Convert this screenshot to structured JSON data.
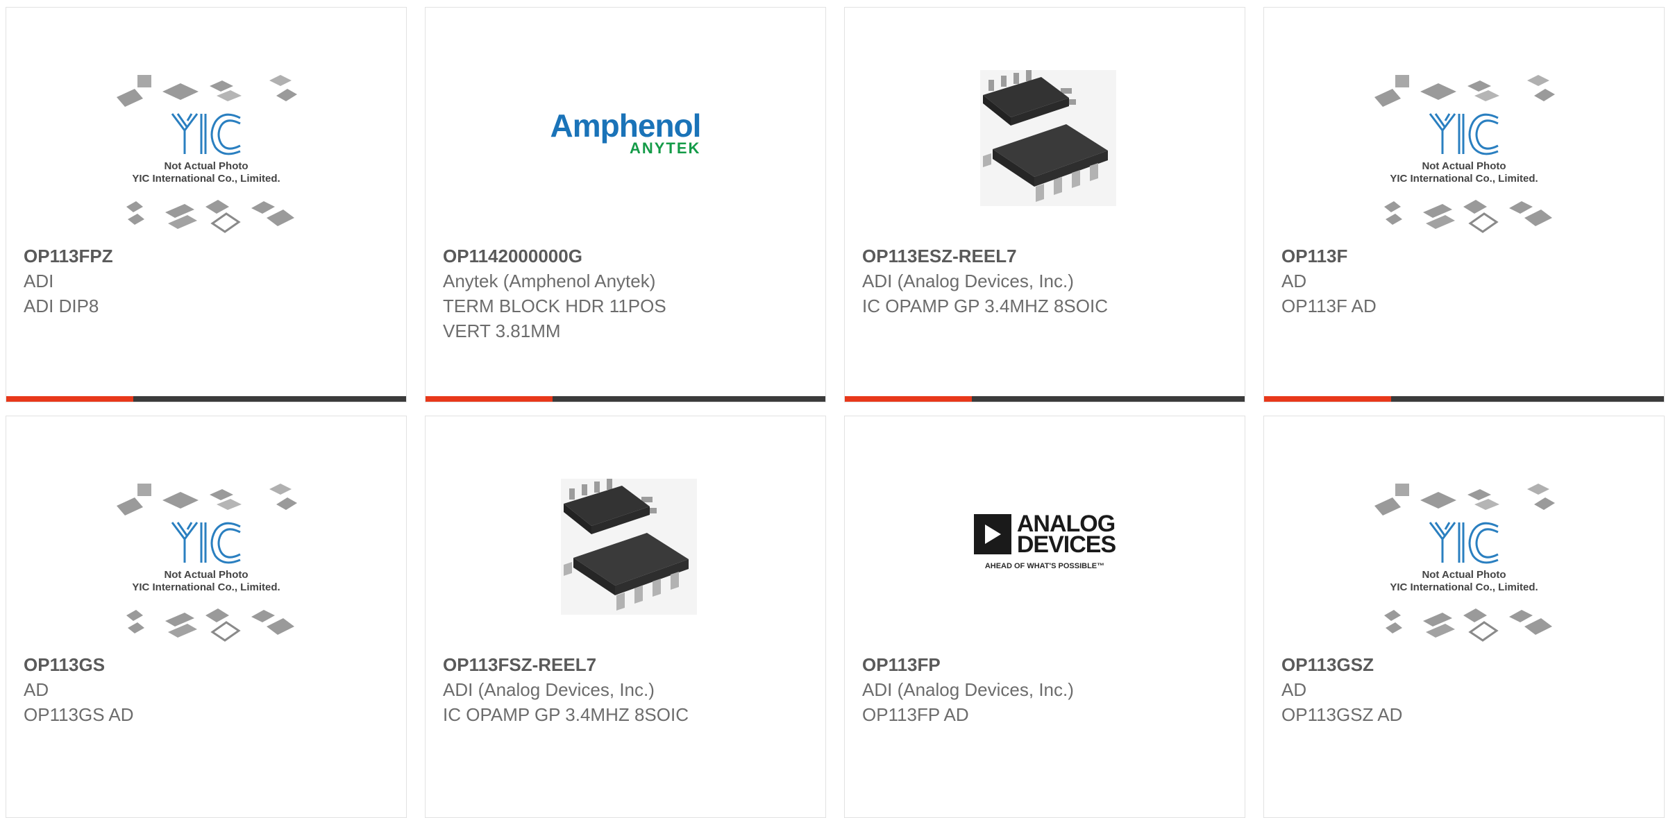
{
  "products": [
    {
      "part_number": "OP113FPZ",
      "manufacturer": "ADI",
      "description": [
        "ADI DIP8"
      ],
      "image": "yic-placeholder",
      "image_caption": [
        "Not Actual Photo",
        "YIC International Co., Limited."
      ]
    },
    {
      "part_number": "OP1142000000G",
      "manufacturer": "Anytek (Amphenol Anytek)",
      "description": [
        "TERM BLOCK HDR 11POS",
        "VERT 3.81MM"
      ],
      "image": "amphenol-logo",
      "logo_text": [
        "Amphenol",
        "ANYTEK"
      ]
    },
    {
      "part_number": "OP113ESZ-REEL7",
      "manufacturer": "ADI (Analog Devices, Inc.)",
      "description": [
        "IC OPAMP GP 3.4MHZ 8SOIC"
      ],
      "image": "soic8-chip"
    },
    {
      "part_number": "OP113F",
      "manufacturer": "AD",
      "description": [
        "OP113F AD"
      ],
      "image": "yic-placeholder",
      "image_caption": [
        "Not Actual Photo",
        "YIC International Co., Limited."
      ]
    },
    {
      "part_number": "OP113GS",
      "manufacturer": "AD",
      "description": [
        "OP113GS AD"
      ],
      "image": "yic-placeholder",
      "image_caption": [
        "Not Actual Photo",
        "YIC International Co., Limited."
      ]
    },
    {
      "part_number": "OP113FSZ-REEL7",
      "manufacturer": "ADI (Analog Devices, Inc.)",
      "description": [
        "IC OPAMP GP 3.4MHZ 8SOIC"
      ],
      "image": "soic8-chip"
    },
    {
      "part_number": "OP113FP",
      "manufacturer": "ADI (Analog Devices, Inc.)",
      "description": [
        "OP113FP AD"
      ],
      "image": "analog-devices-logo",
      "logo_text": [
        "ANALOG",
        "DEVICES",
        "AHEAD OF WHAT'S POSSIBLE™"
      ]
    },
    {
      "part_number": "OP113GSZ",
      "manufacturer": "AD",
      "description": [
        "OP113GSZ AD"
      ],
      "image": "yic-placeholder",
      "image_caption": [
        "Not Actual Photo",
        "YIC International Co., Limited."
      ]
    }
  ],
  "colors": {
    "accent": "#e8381a",
    "bar": "#3b3b3b",
    "text": "#6c6c6c",
    "yic_blue": "#2a7fc0"
  }
}
